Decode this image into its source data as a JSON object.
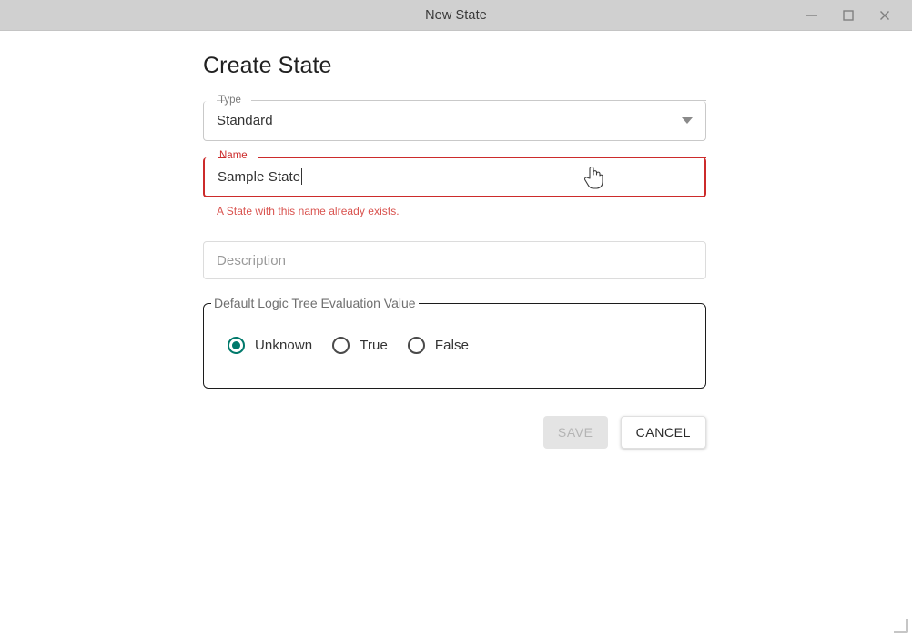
{
  "window": {
    "title": "New State",
    "controls": {
      "minimize": "minimize-icon",
      "maximize": "maximize-icon",
      "close": "close-icon"
    }
  },
  "page": {
    "title": "Create State"
  },
  "form": {
    "type_field": {
      "label": "Type",
      "value": "Standard",
      "icon": "chevron-down-icon"
    },
    "name_field": {
      "label": "Name",
      "value": "Sample State",
      "error": "A State with this name already exists.",
      "error_color": "#cc2b2b",
      "has_error": true
    },
    "description_field": {
      "placeholder": "Description",
      "value": ""
    },
    "evaluation_group": {
      "legend": "Default Logic Tree Evaluation Value",
      "accent_color": "#00796b",
      "options": [
        {
          "label": "Unknown",
          "selected": true
        },
        {
          "label": "True",
          "selected": false
        },
        {
          "label": "False",
          "selected": false
        }
      ]
    }
  },
  "actions": {
    "save_label": "SAVE",
    "save_disabled": true,
    "cancel_label": "CANCEL"
  }
}
